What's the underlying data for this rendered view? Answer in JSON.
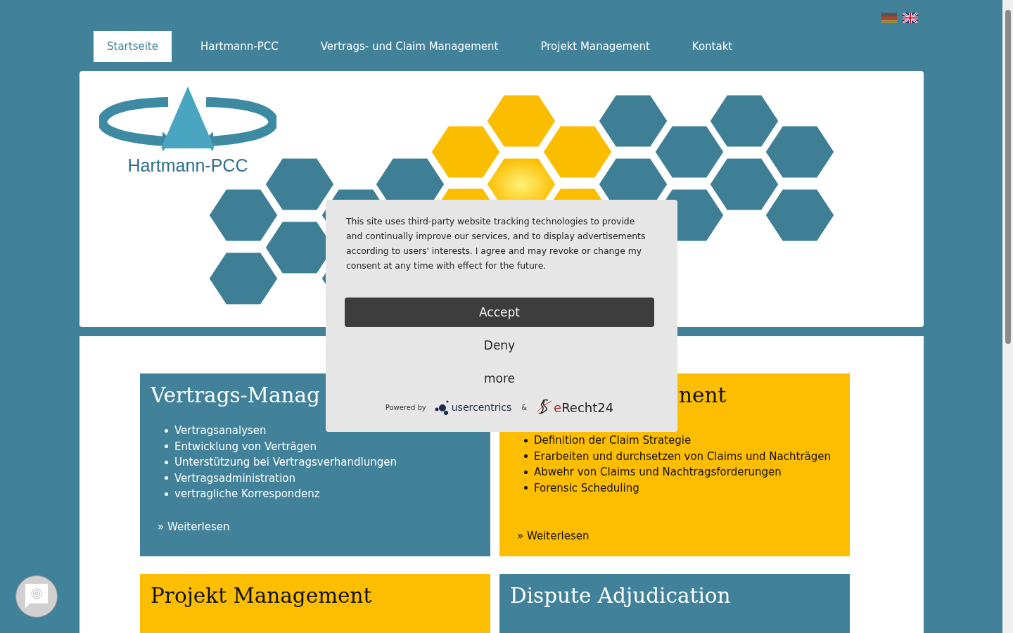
{
  "language_flags": [
    {
      "kind": "de"
    },
    {
      "kind": "en"
    }
  ],
  "nav": [
    {
      "label": "Startseite",
      "selected": true
    },
    {
      "label": "Hartmann-PCC",
      "selected": false
    },
    {
      "label": "Vertrags- und Claim Management",
      "selected": false
    },
    {
      "label": "Projekt Management",
      "selected": false
    },
    {
      "label": "Kontakt",
      "selected": false
    }
  ],
  "banner": {
    "logo_text": "Hartmann-PCC"
  },
  "cards": [
    {
      "kind": "teal",
      "title": "Vertrags-Manag",
      "items": [
        "Vertragsanalysen",
        "Entwicklung von Verträgen",
        "Unterstützung bei Vertragsverhandlungen",
        "Vertragsadministration",
        "vertragliche Korrespondenz"
      ],
      "link": "» Weiterlesen"
    },
    {
      "kind": "gold",
      "title": "nent",
      "items": [
        "Definition der Claim Strategie",
        "Erarbeiten und durchsetzen von Claims und Nachträgen",
        "Abwehr von Claims und Nachtragsforderungen",
        "Forensic Scheduling"
      ],
      "link": "» Weiterlesen"
    },
    {
      "kind": "gold",
      "title": "Projekt Management"
    },
    {
      "kind": "teal",
      "title": "Dispute Adjudication"
    }
  ],
  "consent": {
    "text": "This site uses third-party website tracking technologies to provide and continually improve our services, and to display advertisements according to users' interests. I agree and may revoke or change my consent at any time with effect for the future.",
    "buttons": [
      {
        "label": "Accept",
        "kind": "primary"
      },
      {
        "label": "Deny",
        "kind": "plain"
      },
      {
        "label": "more",
        "kind": "plain"
      }
    ],
    "powered_by": "Powered by",
    "brand_1": "usercentrics",
    "ampersand": "&",
    "brand_2": "eRecht24"
  }
}
